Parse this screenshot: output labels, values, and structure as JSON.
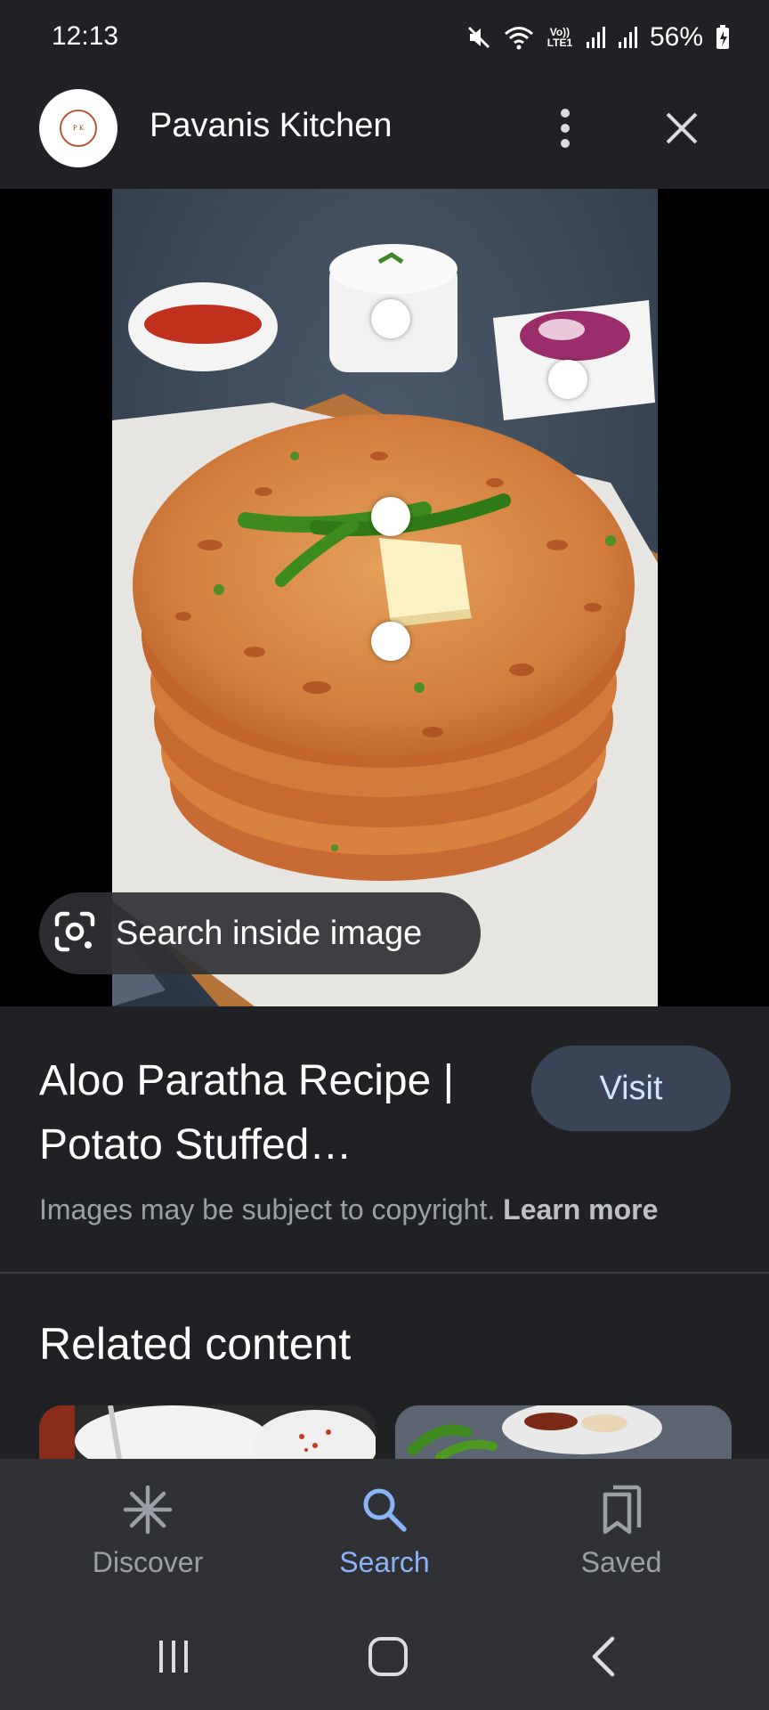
{
  "status_bar": {
    "time": "12:13",
    "network_label": "Vo)) LTE1",
    "battery_percent": "56%",
    "icons": [
      "mute-icon",
      "wifi-icon",
      "volte-icon",
      "signal-icon",
      "signal-icon",
      "battery-charging-icon"
    ]
  },
  "app_bar": {
    "site_name": "Pavanis Kitchen",
    "avatar_text": "Pavanis Kitchen",
    "more_icon": "more-vert-icon",
    "close_icon": "close-icon"
  },
  "viewer": {
    "image_subject": "Stack of aloo parathas with butter, green chillies, curd, red onions and ketchup",
    "search_inside_label": "Search inside image",
    "hotspot_count": 4
  },
  "result": {
    "title": "Aloo Paratha Recipe | Potato Stuffed…",
    "visit_label": "Visit",
    "copyright_text": "Images may be subject to copyright.",
    "learn_more_label": "Learn more"
  },
  "related": {
    "title": "Related content"
  },
  "bottom_nav": {
    "items": [
      {
        "label": "Discover",
        "icon": "asterisk-icon",
        "active": false
      },
      {
        "label": "Search",
        "icon": "search-icon",
        "active": true
      },
      {
        "label": "Saved",
        "icon": "bookmarks-icon",
        "active": false
      }
    ]
  },
  "system_nav": {
    "recents_icon": "recents-icon",
    "home_icon": "home-icon",
    "back_icon": "back-icon"
  },
  "colors": {
    "background": "#202124",
    "nav_background": "#303134",
    "accent": "#8ab4f8",
    "visit_button": "#394457"
  }
}
